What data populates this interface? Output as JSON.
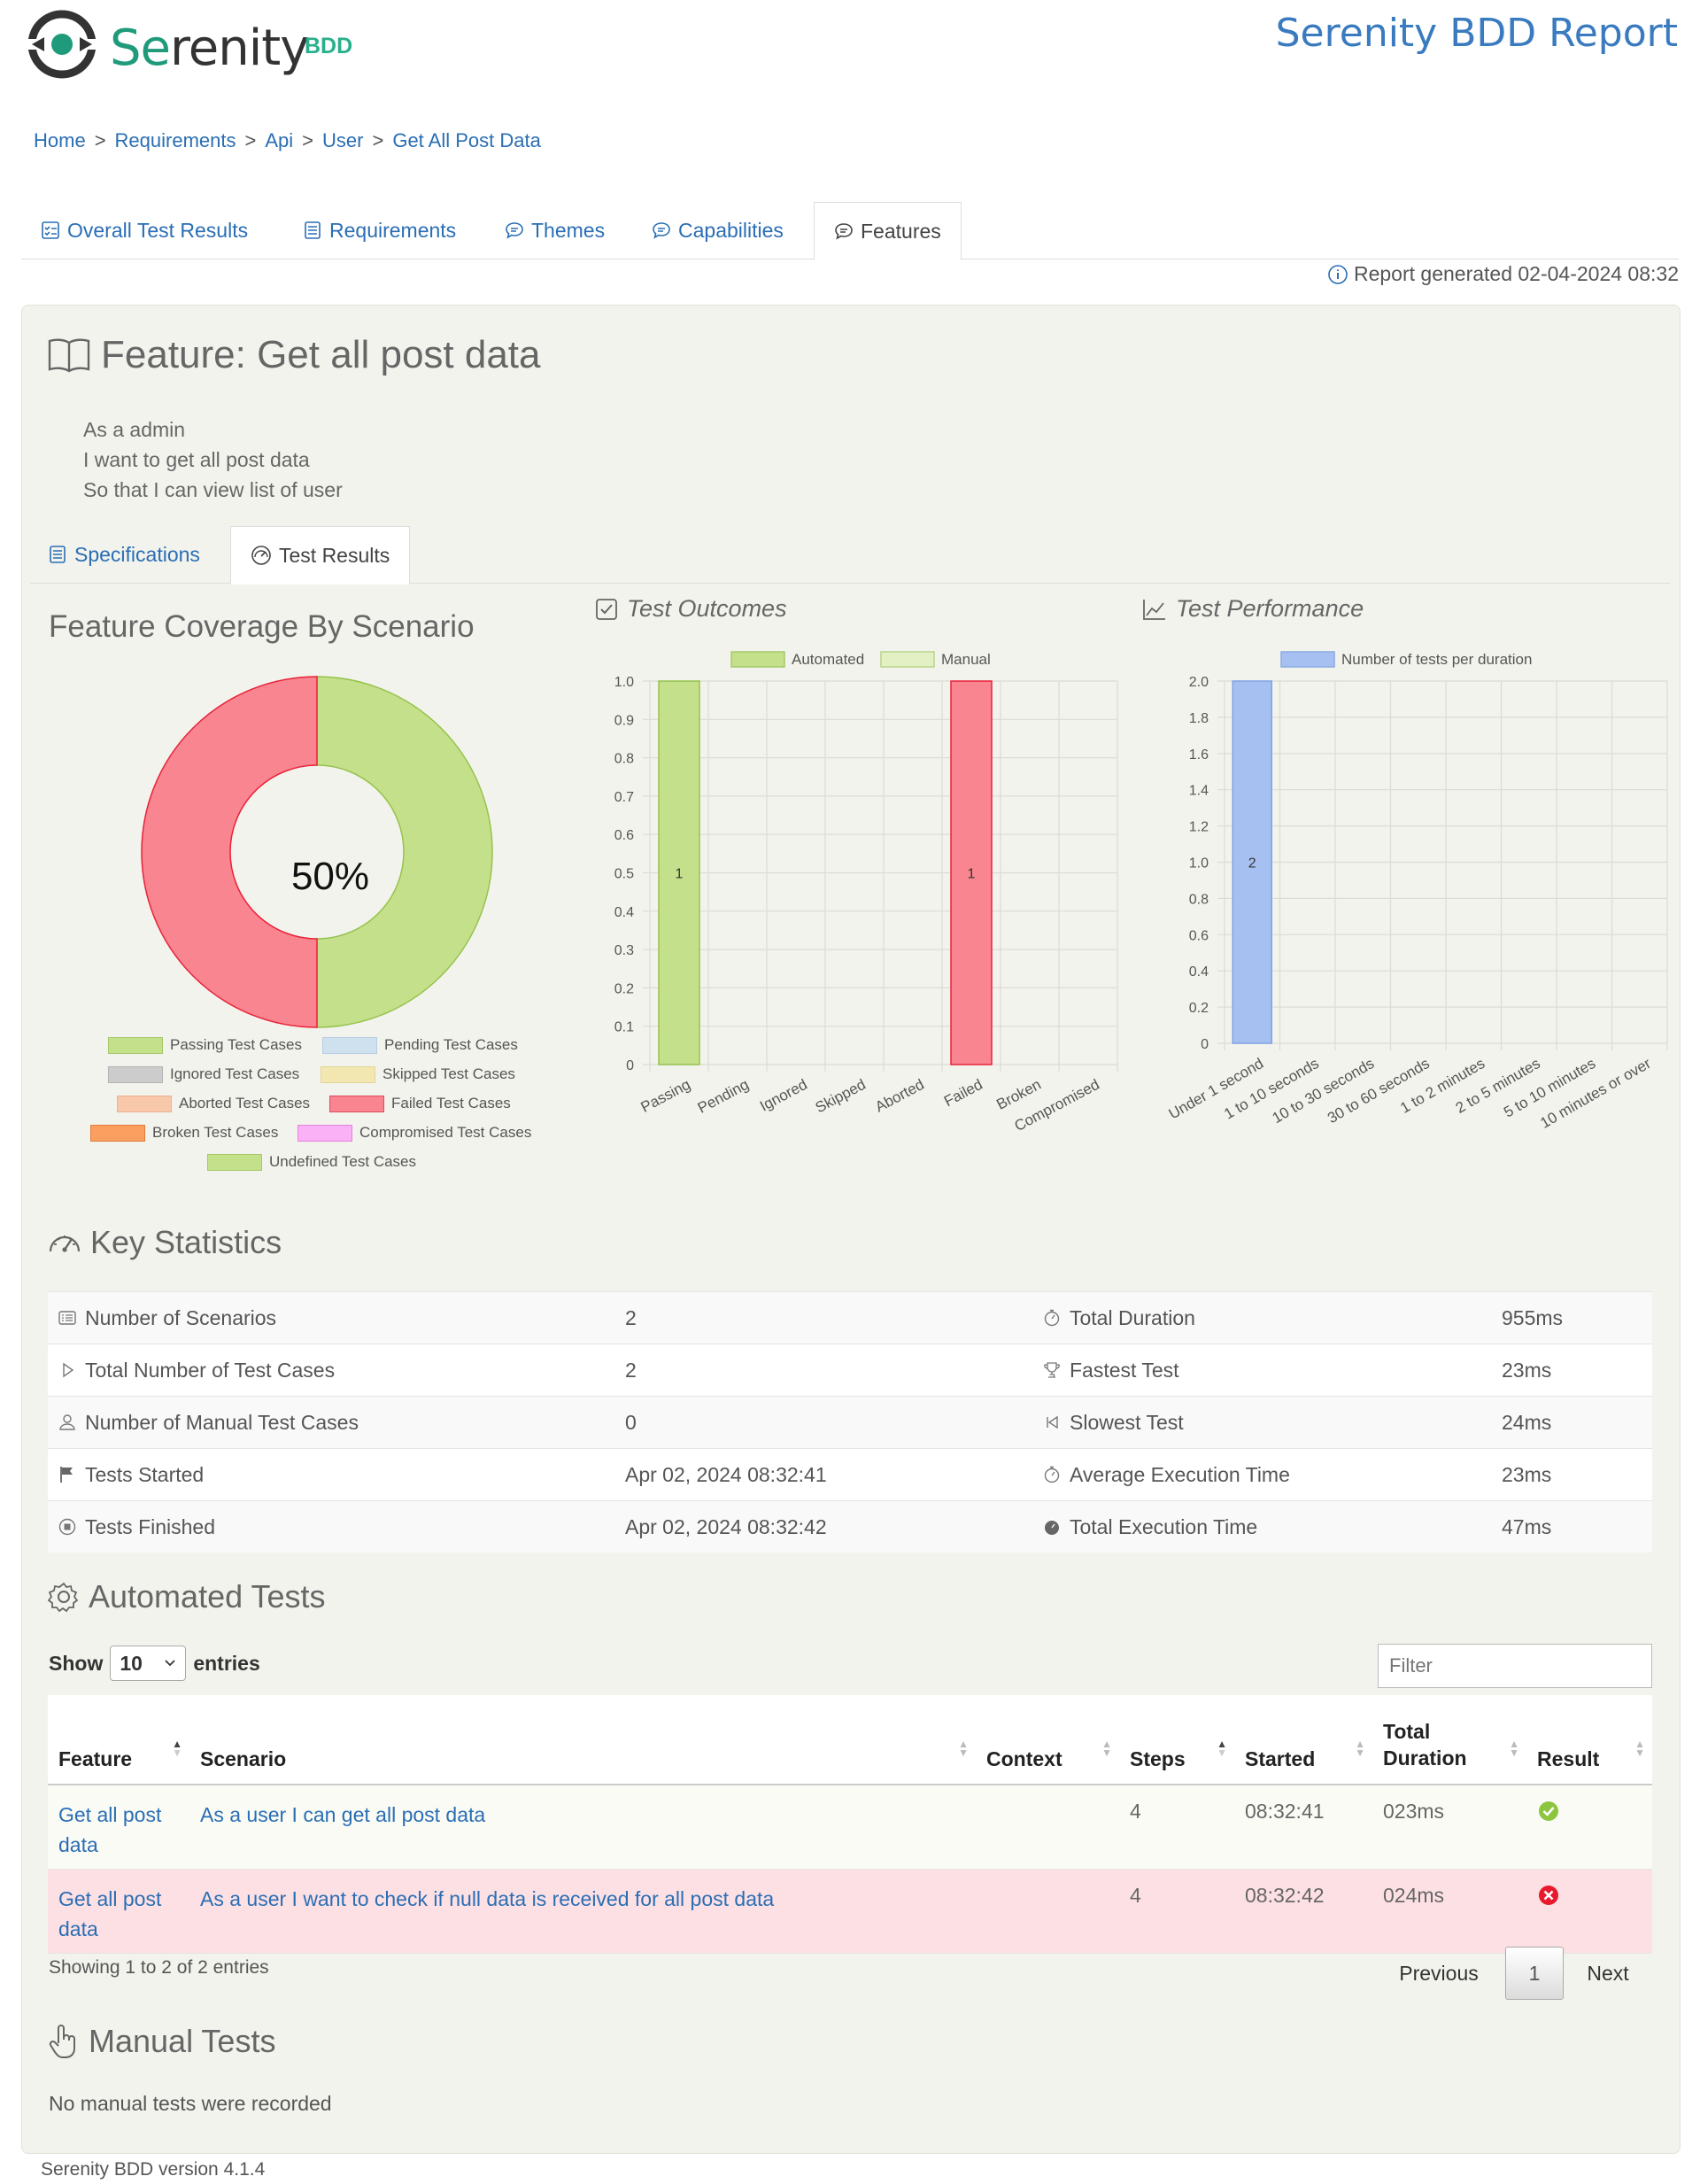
{
  "header": {
    "logo_text_a": "Se",
    "logo_text_b": "renity",
    "logo_suffix": "BDD",
    "report_title": "Serenity BDD Report"
  },
  "breadcrumb": [
    "Home",
    "Requirements",
    "Api",
    "User",
    "Get All Post Data"
  ],
  "breadcrumb_sep": ">",
  "tabs": [
    {
      "label": "Overall Test Results",
      "icon": "checklist-icon"
    },
    {
      "label": "Requirements",
      "icon": "list-icon"
    },
    {
      "label": "Themes",
      "icon": "comment-icon"
    },
    {
      "label": "Capabilities",
      "icon": "comment-icon"
    },
    {
      "label": "Features",
      "icon": "comment-icon",
      "active": true
    }
  ],
  "report_generated": "Report generated 02-04-2024 08:32",
  "feature": {
    "title": "Feature: Get all post data",
    "narrative": [
      "As a admin",
      "I want to get all post data",
      "So that I can view list of user"
    ]
  },
  "inner_tabs": [
    {
      "label": "Specifications",
      "icon": "list-icon"
    },
    {
      "label": "Test Results",
      "icon": "gauge-icon",
      "active": true
    }
  ],
  "coverage": {
    "title": "Feature Coverage By Scenario",
    "center_label": "50%",
    "legend": [
      {
        "label": "Passing Test Cases",
        "color": "#c5e08a",
        "border": "#a5c96a"
      },
      {
        "label": "Pending Test Cases",
        "color": "#cfe0ef",
        "border": "#b7cde2"
      },
      {
        "label": "Ignored Test Cases",
        "color": "#cccccc",
        "border": "#b3b3b3"
      },
      {
        "label": "Skipped Test Cases",
        "color": "#f3e7b1",
        "border": "#e2d49a"
      },
      {
        "label": "Aborted Test Cases",
        "color": "#f8c8aa",
        "border": "#eeb18c"
      },
      {
        "label": "Failed Test Cases",
        "color": "#f8858f",
        "border": "#e04a58"
      },
      {
        "label": "Broken Test Cases",
        "color": "#fa9f60",
        "border": "#e07c3a"
      },
      {
        "label": "Compromised Test Cases",
        "color": "#fbb1f6",
        "border": "#e682de"
      },
      {
        "label": "Undefined Test Cases",
        "color": "#c5e08a",
        "border": "#a5c96a"
      }
    ]
  },
  "outcomes": {
    "title": "Test Outcomes",
    "legend": [
      {
        "label": "Automated",
        "color": "#c5e08a",
        "border": "#a5c96a"
      },
      {
        "label": "Manual",
        "color": "#e3f0c4",
        "border": "#b8d58a"
      }
    ]
  },
  "performance": {
    "title": "Test Performance",
    "legend": [
      {
        "label": "Number of tests per duration",
        "color": "#a6c1f1",
        "border": "#8aaae0"
      }
    ]
  },
  "chart_data": [
    {
      "type": "pie",
      "categories": [
        "Passing Test Cases",
        "Failed Test Cases"
      ],
      "values": [
        50,
        50
      ],
      "colors": [
        "#c5e08a",
        "#f8858f"
      ],
      "center_label": "50%"
    },
    {
      "type": "bar",
      "title": "Test Outcomes",
      "categories": [
        "Passing",
        "Pending",
        "Ignored",
        "Skipped",
        "Aborted",
        "Failed",
        "Broken",
        "Compromised"
      ],
      "series": [
        {
          "name": "Automated",
          "values": [
            1,
            0,
            0,
            0,
            0,
            1,
            0,
            0
          ],
          "colors": [
            "#c5e08a",
            null,
            null,
            null,
            null,
            "#f8858f",
            null,
            null
          ]
        },
        {
          "name": "Manual",
          "values": [
            0,
            0,
            0,
            0,
            0,
            0,
            0,
            0
          ]
        }
      ],
      "bar_labels": [
        "1",
        "",
        "",
        "",
        "",
        "1",
        "",
        ""
      ],
      "ylim": [
        0,
        1.0
      ],
      "yticks": [
        "0",
        "0.1",
        "0.2",
        "0.3",
        "0.4",
        "0.5",
        "0.6",
        "0.7",
        "0.8",
        "0.9",
        "1.0"
      ]
    },
    {
      "type": "bar",
      "title": "Test Performance",
      "categories": [
        "Under 1 second",
        "1 to 10 seconds",
        "10 to 30 seconds",
        "30 to 60 seconds",
        "1 to 2 minutes",
        "2 to 5 minutes",
        "5 to 10 minutes",
        "10 minutes or over"
      ],
      "series": [
        {
          "name": "Number of tests per duration",
          "values": [
            2,
            0,
            0,
            0,
            0,
            0,
            0,
            0
          ]
        }
      ],
      "bar_labels": [
        "2",
        "",
        "",
        "",
        "",
        "",
        "",
        ""
      ],
      "ylim": [
        0,
        2.0
      ],
      "yticks": [
        "0",
        "0.2",
        "0.4",
        "0.6",
        "0.8",
        "1.0",
        "1.2",
        "1.4",
        "1.6",
        "1.8",
        "2.0"
      ]
    }
  ],
  "key_statistics": {
    "title": "Key Statistics",
    "rows": [
      {
        "l_label": "Number of Scenarios",
        "l_icon": "list-icon",
        "l_value": "2",
        "r_label": "Total Duration",
        "r_icon": "stopwatch-icon",
        "r_value": "955ms"
      },
      {
        "l_label": "Total Number of Test Cases",
        "l_icon": "play-icon",
        "l_value": "2",
        "r_label": "Fastest Test",
        "r_icon": "trophy-icon",
        "r_value": "23ms"
      },
      {
        "l_label": "Number of Manual Test Cases",
        "l_icon": "user-icon",
        "l_value": "0",
        "r_label": "Slowest Test",
        "r_icon": "skip-back-icon",
        "r_value": "24ms"
      },
      {
        "l_label": "Tests Started",
        "l_icon": "flag-icon",
        "l_value": "Apr 02, 2024 08:32:41",
        "r_label": "Average Execution Time",
        "r_icon": "stopwatch-icon",
        "r_value": "23ms"
      },
      {
        "l_label": "Tests Finished",
        "l_icon": "stop-icon",
        "l_value": "Apr 02, 2024 08:32:42",
        "r_label": "Total Execution Time",
        "r_icon": "stopwatch-filled-icon",
        "r_value": "47ms"
      }
    ]
  },
  "automated_tests": {
    "title": "Automated Tests",
    "show_label": "Show",
    "page_size": "10",
    "entries_label": "entries",
    "filter_placeholder": "Filter",
    "columns": [
      "Feature",
      "Scenario",
      "Context",
      "Steps",
      "Started",
      "Total Duration",
      "Result"
    ],
    "rows": [
      {
        "feature": "Get all post data",
        "scenario": "As a user I can get all post data",
        "context": "",
        "steps": "4",
        "started": "08:32:41",
        "duration": "023ms",
        "result": "passed"
      },
      {
        "feature": "Get all post data",
        "scenario": "As a user I want to check if null data is received for all post data",
        "context": "",
        "steps": "4",
        "started": "08:32:42",
        "duration": "024ms",
        "result": "failed"
      }
    ],
    "showing": "Showing 1 to 2 of 2 entries",
    "pagination": {
      "previous": "Previous",
      "current": "1",
      "next": "Next"
    }
  },
  "manual_tests": {
    "title": "Manual Tests",
    "empty_text": "No manual tests were recorded"
  },
  "footer": {
    "version": "Serenity BDD version 4.1.4"
  }
}
